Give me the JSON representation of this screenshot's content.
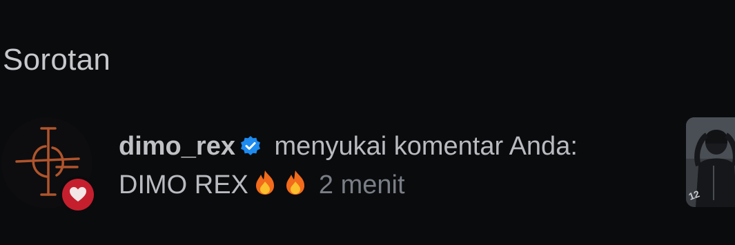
{
  "section": {
    "title": "Sorotan"
  },
  "notification": {
    "username": "dimo_rex",
    "action": " menyukai komentar Anda:",
    "comment": "DIMO REX",
    "comment_emojis": [
      "fire",
      "fire"
    ],
    "time": "2 menit",
    "avatar_icon": "cross-logo-avatar",
    "badge_icon": "heart-icon",
    "verified_icon": "verified-badge-icon",
    "post_thumbnail_icon": "post-thumbnail",
    "thumbnail_text": "12"
  },
  "colors": {
    "background": "#0a0b0d",
    "like_badge": "#c51f2e",
    "verified": "#1d8bf0",
    "text": "#b9bbc0",
    "time": "#7a7e86"
  }
}
